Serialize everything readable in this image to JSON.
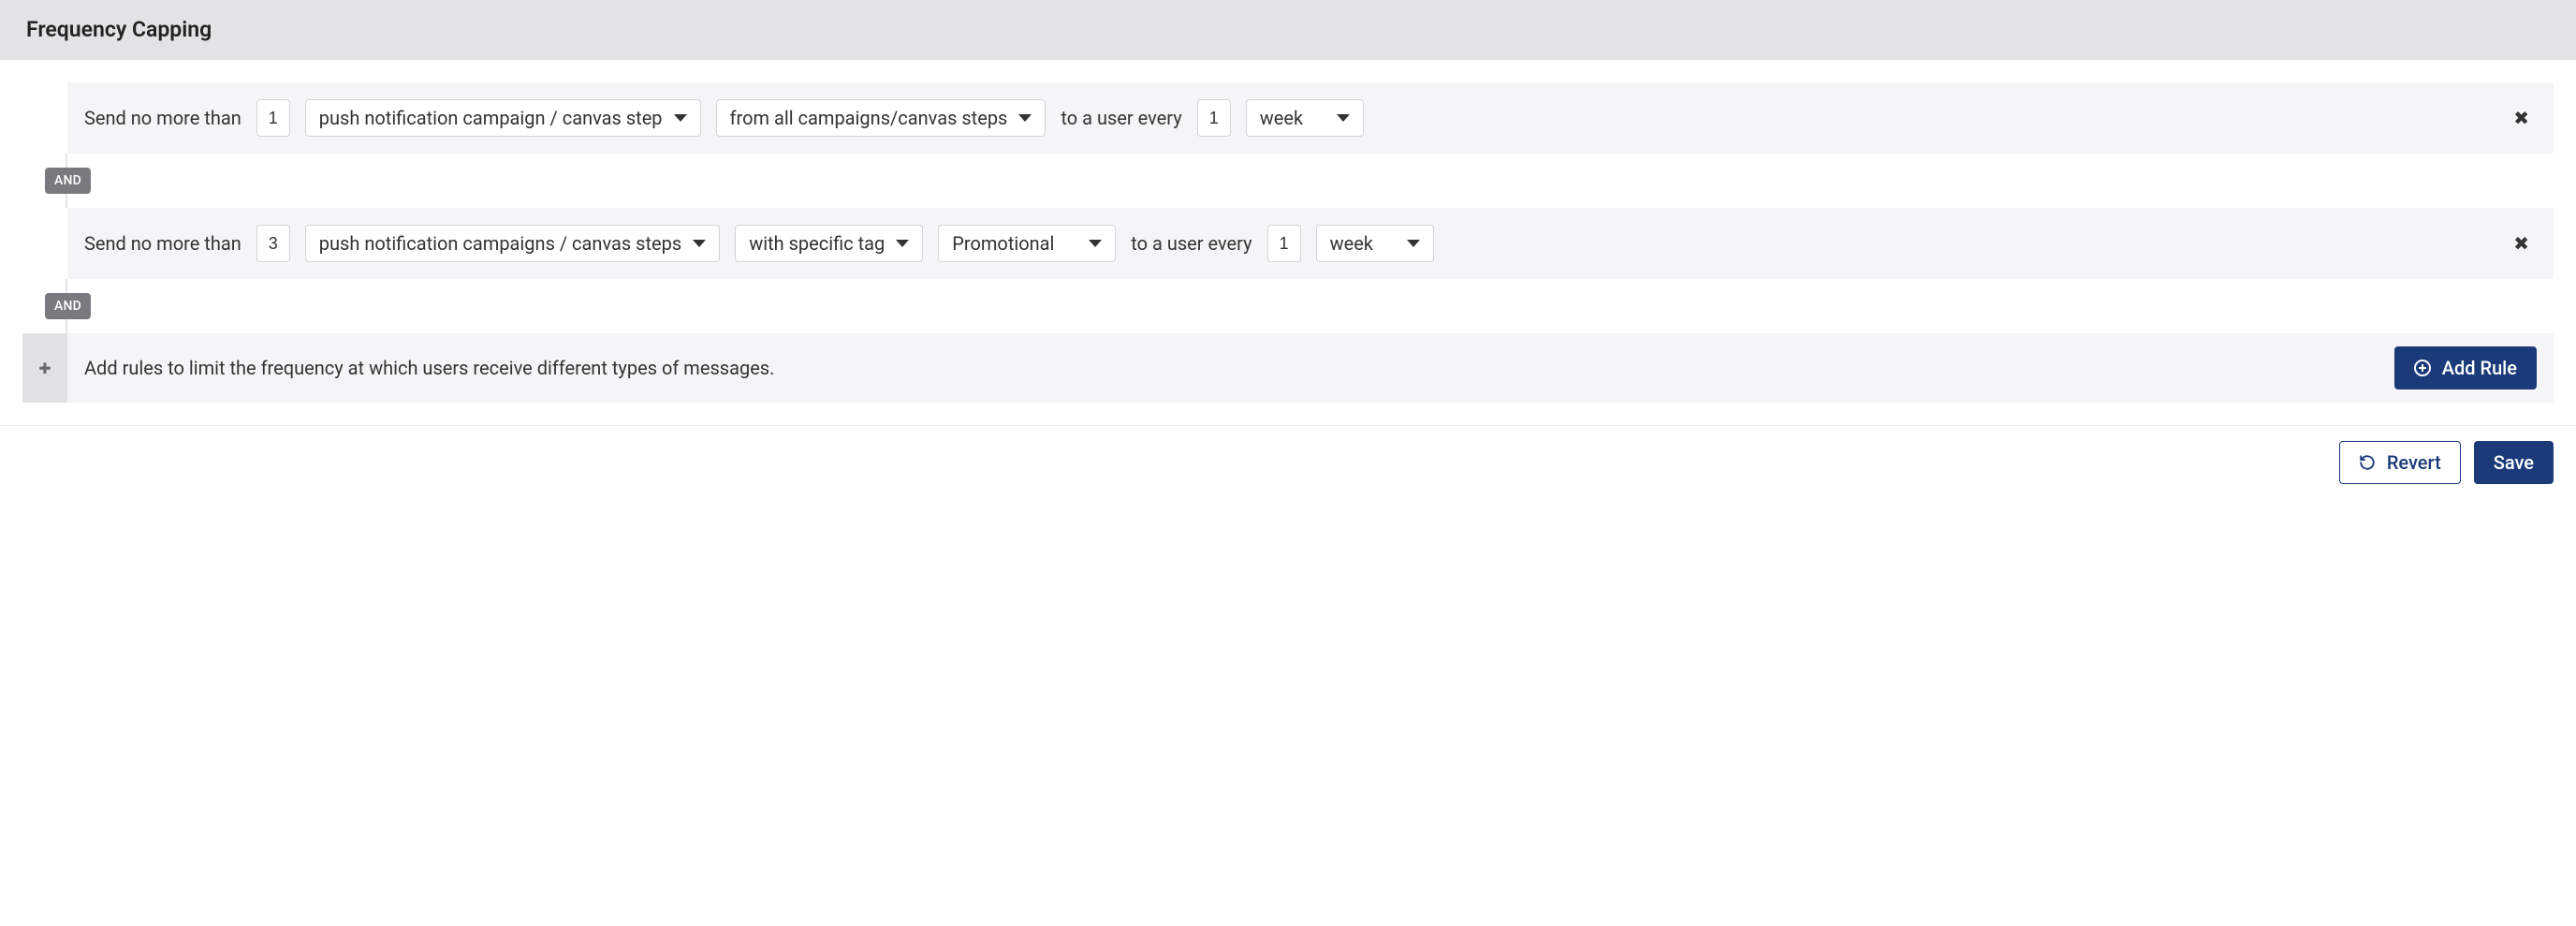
{
  "header": {
    "title": "Frequency Capping"
  },
  "connector_label": "AND",
  "rules": [
    {
      "prefix": "Send no more than",
      "count": "1",
      "channel": "push notification campaign / canvas step",
      "scope": "from all campaigns/canvas steps",
      "tag": null,
      "mid": "to a user every",
      "interval_num": "1",
      "interval_unit": "week"
    },
    {
      "prefix": "Send no more than",
      "count": "3",
      "channel": "push notification campaigns / canvas steps",
      "scope": "with specific tag",
      "tag": "Promotional",
      "mid": "to a user every",
      "interval_num": "1",
      "interval_unit": "week"
    }
  ],
  "add_section": {
    "hint": "Add rules to limit the frequency at which users receive different types of messages.",
    "button": "Add Rule"
  },
  "footer": {
    "revert": "Revert",
    "save": "Save"
  }
}
